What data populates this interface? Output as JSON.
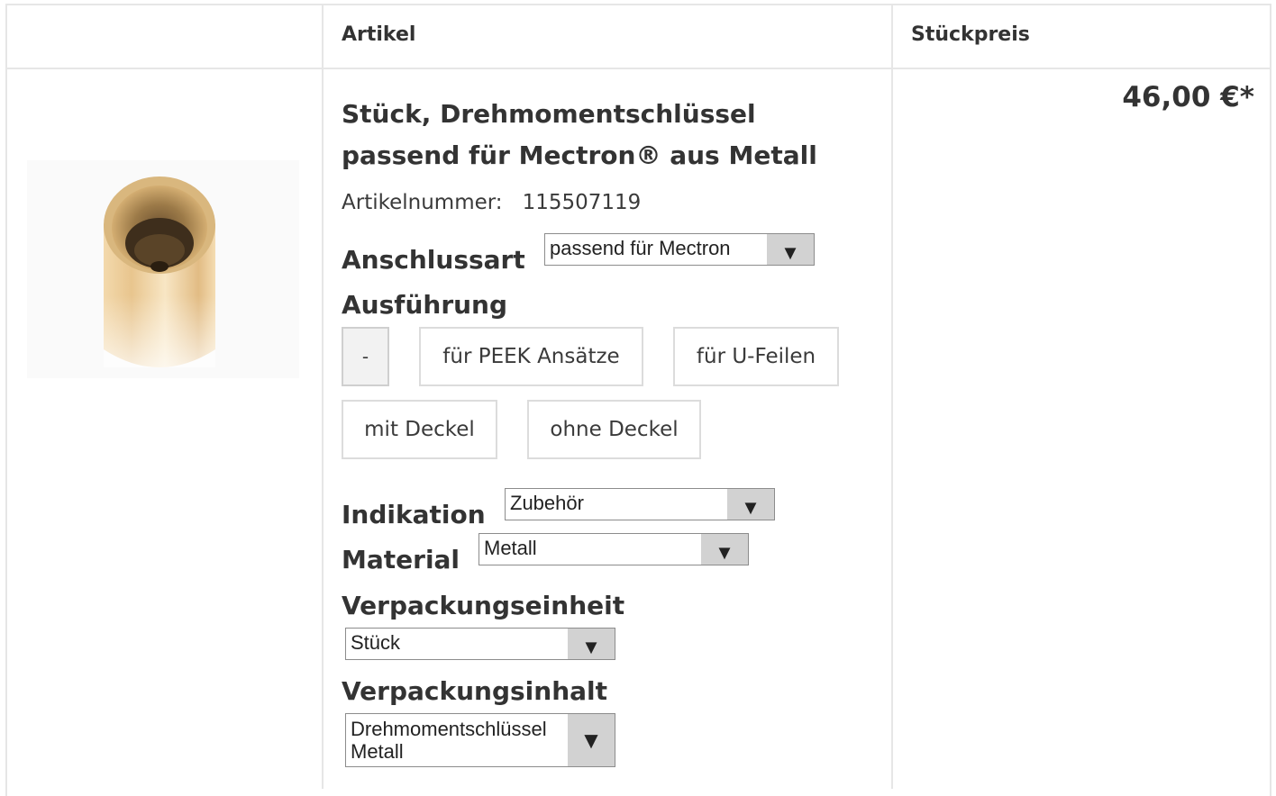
{
  "table": {
    "col_image": "",
    "col_article": "Artikel",
    "col_price": "Stückpreis"
  },
  "product": {
    "title": "Stück, Drehmomentschlüssel passend für Mectron® aus Metall",
    "article_number_label": "Artikelnummer:",
    "article_number": "115507119",
    "price": "46,00 €*",
    "image_icon": "product-image-gold-cylinder"
  },
  "options": {
    "anschlussart_label": "Anschlussart",
    "anschlussart_value": "passend für Mectron",
    "ausfuehrung_label": "Ausführung",
    "ausfuehrung_buttons": [
      "-",
      "für PEEK Ansätze",
      "für U-Feilen",
      "mit Deckel",
      "ohne Deckel"
    ],
    "indikation_label": "Indikation",
    "indikation_value": "Zubehör",
    "material_label": "Material",
    "material_value": "Metall",
    "verpackungseinheit_label": "Verpackungseinheit",
    "verpackungseinheit_value": "Stück",
    "verpackungsinhalt_label": "Verpackungsinhalt",
    "verpackungsinhalt_value_line1": "Drehmomentschlüssel",
    "verpackungsinhalt_value_line2": "Metall"
  },
  "arrow_glyph": "▼"
}
